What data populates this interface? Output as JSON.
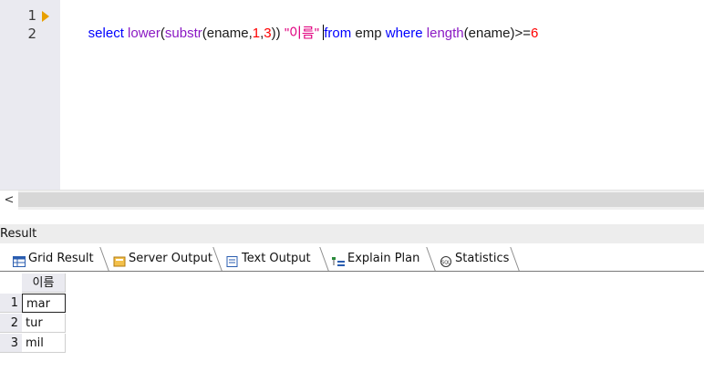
{
  "editor": {
    "line_numbers": [
      "1",
      "2"
    ],
    "tokens": [
      {
        "text": "select ",
        "kind": "kw"
      },
      {
        "text": "lower",
        "kind": "fn"
      },
      {
        "text": "(",
        "kind": "plain"
      },
      {
        "text": "substr",
        "kind": "fn"
      },
      {
        "text": "(ename,",
        "kind": "plain"
      },
      {
        "text": "1",
        "kind": "num"
      },
      {
        "text": ",",
        "kind": "plain"
      },
      {
        "text": "3",
        "kind": "num"
      },
      {
        "text": ")) ",
        "kind": "plain"
      },
      {
        "text": "\"이름\" ",
        "kind": "str"
      },
      {
        "text": "from",
        "kind": "kw"
      },
      {
        "text": " emp ",
        "kind": "plain"
      },
      {
        "text": "where ",
        "kind": "kw"
      },
      {
        "text": "length",
        "kind": "fn"
      },
      {
        "text": "(ename)>=",
        "kind": "plain"
      },
      {
        "text": "6",
        "kind": "num"
      }
    ]
  },
  "scrollbar": {
    "left_arrow": "<"
  },
  "result": {
    "title": "Result",
    "tabs": [
      {
        "label": "Grid Result",
        "icon": "grid-icon"
      },
      {
        "label": "Server Output",
        "icon": "server-output-icon"
      },
      {
        "label": "Text Output",
        "icon": "text-output-icon"
      },
      {
        "label": "Explain Plan",
        "icon": "explain-plan-icon"
      },
      {
        "label": "Statistics",
        "icon": "statistics-icon"
      }
    ],
    "grid": {
      "column": "이름",
      "rows": [
        {
          "num": "1",
          "value": "mar"
        },
        {
          "num": "2",
          "value": "tur"
        },
        {
          "num": "3",
          "value": "mil"
        }
      ]
    }
  },
  "colors": {
    "keyword": "#0000ff",
    "function": "#8b1ac4",
    "number": "#ff0000",
    "string": "#e0007f",
    "gutter": "#eaeaf0"
  }
}
